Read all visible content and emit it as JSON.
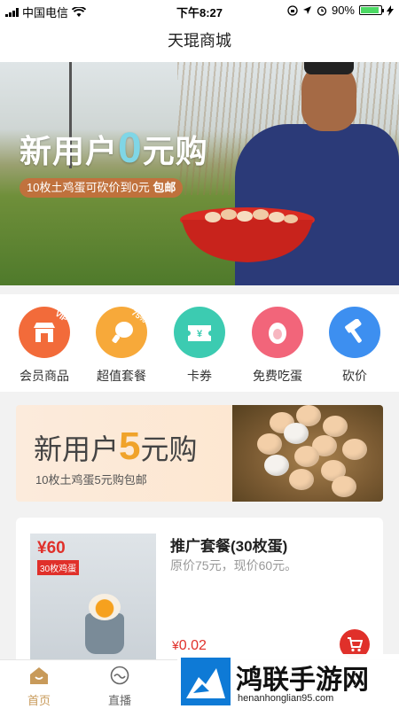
{
  "status_bar": {
    "carrier": "中国电信",
    "time": "下午8:27",
    "battery": "90%",
    "battery_level": 0.9
  },
  "nav": {
    "title": "天琨商城"
  },
  "hero": {
    "title_prefix": "新用户",
    "title_number": "0",
    "title_suffix": "元购",
    "subtitle": "10枚土鸡蛋可砍价到0元",
    "subtitle_tag": "包邮"
  },
  "menu": {
    "items": [
      {
        "label": "会员商品",
        "icon": "vip-store-icon",
        "color": "#f26b3a"
      },
      {
        "label": "超值套餐",
        "icon": "chicken-leg-icon",
        "color": "#f7a93a"
      },
      {
        "label": "卡券",
        "icon": "coupon-icon",
        "color": "#3ccbb1"
      },
      {
        "label": "免费吃蛋",
        "icon": "egg-icon",
        "color": "#f2657a"
      },
      {
        "label": "砍价",
        "icon": "hammer-icon",
        "color": "#3d8ff0"
      }
    ],
    "vip_badge": "VIP",
    "percent_badge": "75%"
  },
  "promo": {
    "title_prefix": "新用户",
    "title_number": "5",
    "title_suffix": "元购",
    "subtitle": "10枚土鸡蛋5元购包邮"
  },
  "product": {
    "thumb_price": "¥60",
    "thumb_tag": "30枚鸡蛋",
    "title": "推广套餐(30枚蛋)",
    "description": "原价75元，现价60元。",
    "price_symbol": "¥",
    "price": "0.02"
  },
  "tabbar": {
    "tabs": [
      {
        "label": "首页",
        "icon": "home-icon"
      },
      {
        "label": "直播",
        "icon": "live-icon"
      }
    ]
  },
  "watermark": {
    "text": "鸿联手游网",
    "url": "henanhonglian95.com"
  },
  "colors": {
    "accent_red": "#e0302a",
    "tab_active": "#c89a5a",
    "promo_number": "#f0a32a"
  }
}
